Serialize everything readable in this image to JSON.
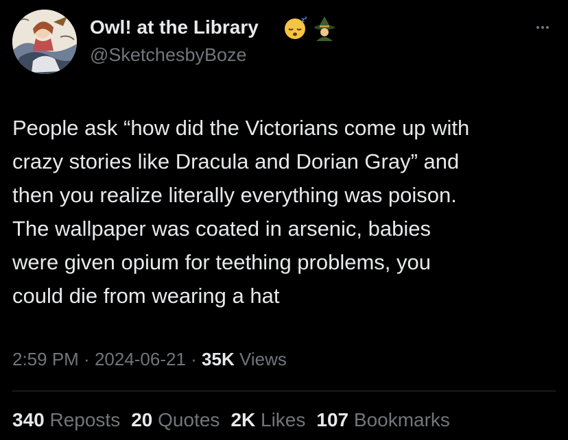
{
  "author": {
    "name": "Owl! at the Library",
    "handle": "@SketchesbyBoze",
    "badges": [
      "sleeping-face-emoji",
      "witch-emoji"
    ]
  },
  "tweet": {
    "text": "People ask “how did the Victorians come up with\ncrazy stories like Dracula and Dorian Gray” and\nthen you realize literally everything was poison.\nThe wallpaper was coated in arsenic, babies\nwere given opium for teething problems, you\ncould die from wearing a hat"
  },
  "meta": {
    "time": "2:59 PM",
    "sep1": " · ",
    "date": "2024-06-21",
    "sep2": " · ",
    "views_count": "35K",
    "views_label": " Views"
  },
  "stats": {
    "reposts": {
      "count": "340",
      "label": " Reposts"
    },
    "quotes": {
      "count": "20",
      "label": " Quotes"
    },
    "likes": {
      "count": "2K",
      "label": " Likes"
    },
    "bookmarks": {
      "count": "107",
      "label": " Bookmarks"
    }
  },
  "colors": {
    "background": "#000000",
    "text_primary": "#e7e9ea",
    "text_secondary": "#71767b",
    "divider": "#2f3336"
  }
}
